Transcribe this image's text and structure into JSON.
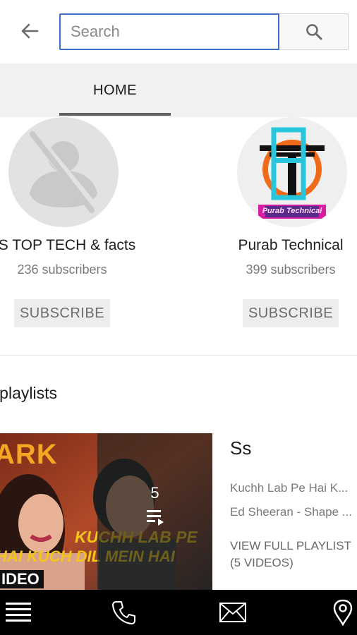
{
  "search": {
    "placeholder": "Search",
    "back_icon": "arrow-left-icon",
    "search_icon": "magnifier-icon"
  },
  "tabs": [
    {
      "label": "HOME",
      "selected": true
    }
  ],
  "channels": [
    {
      "name": "PS TOP TECH & facts",
      "subscribers": "236 subscribers",
      "subscribe_label": "SUBSCRIBE",
      "avatar": "default-avatar-icon"
    },
    {
      "name": "Purab Technical",
      "subscribers": "399 subscribers",
      "subscribe_label": "SUBSCRIBE",
      "avatar": "purab-technical-logo",
      "avatar_text": "Purab Technical"
    }
  ],
  "playlists_section": {
    "title": "d playlists"
  },
  "playlist": {
    "title": "Ss",
    "video_count": "5",
    "videos": [
      "Kuchh Lab Pe Hai K...",
      "Ed Sheeran - Shape ..."
    ],
    "view_full_label": "VIEW FULL PLAYLIST (5 VIDEOS)",
    "thumbnail_text": {
      "top": "ARK",
      "line1": "KUCHH LAB PE",
      "line2": "HAI KUCH DIL MEIN HAI",
      "tag": "IDEO"
    }
  },
  "bottom_nav": [
    {
      "icon": "menu-icon"
    },
    {
      "icon": "phone-icon"
    },
    {
      "icon": "mail-icon"
    },
    {
      "icon": "location-pin-icon"
    }
  ],
  "colors": {
    "accent": "#3e6fc4",
    "tab_bar": "#f1f1f1",
    "tab_indicator": "#606060",
    "bottom_nav": "#000000",
    "thumbnail_text": "#f5c518"
  }
}
